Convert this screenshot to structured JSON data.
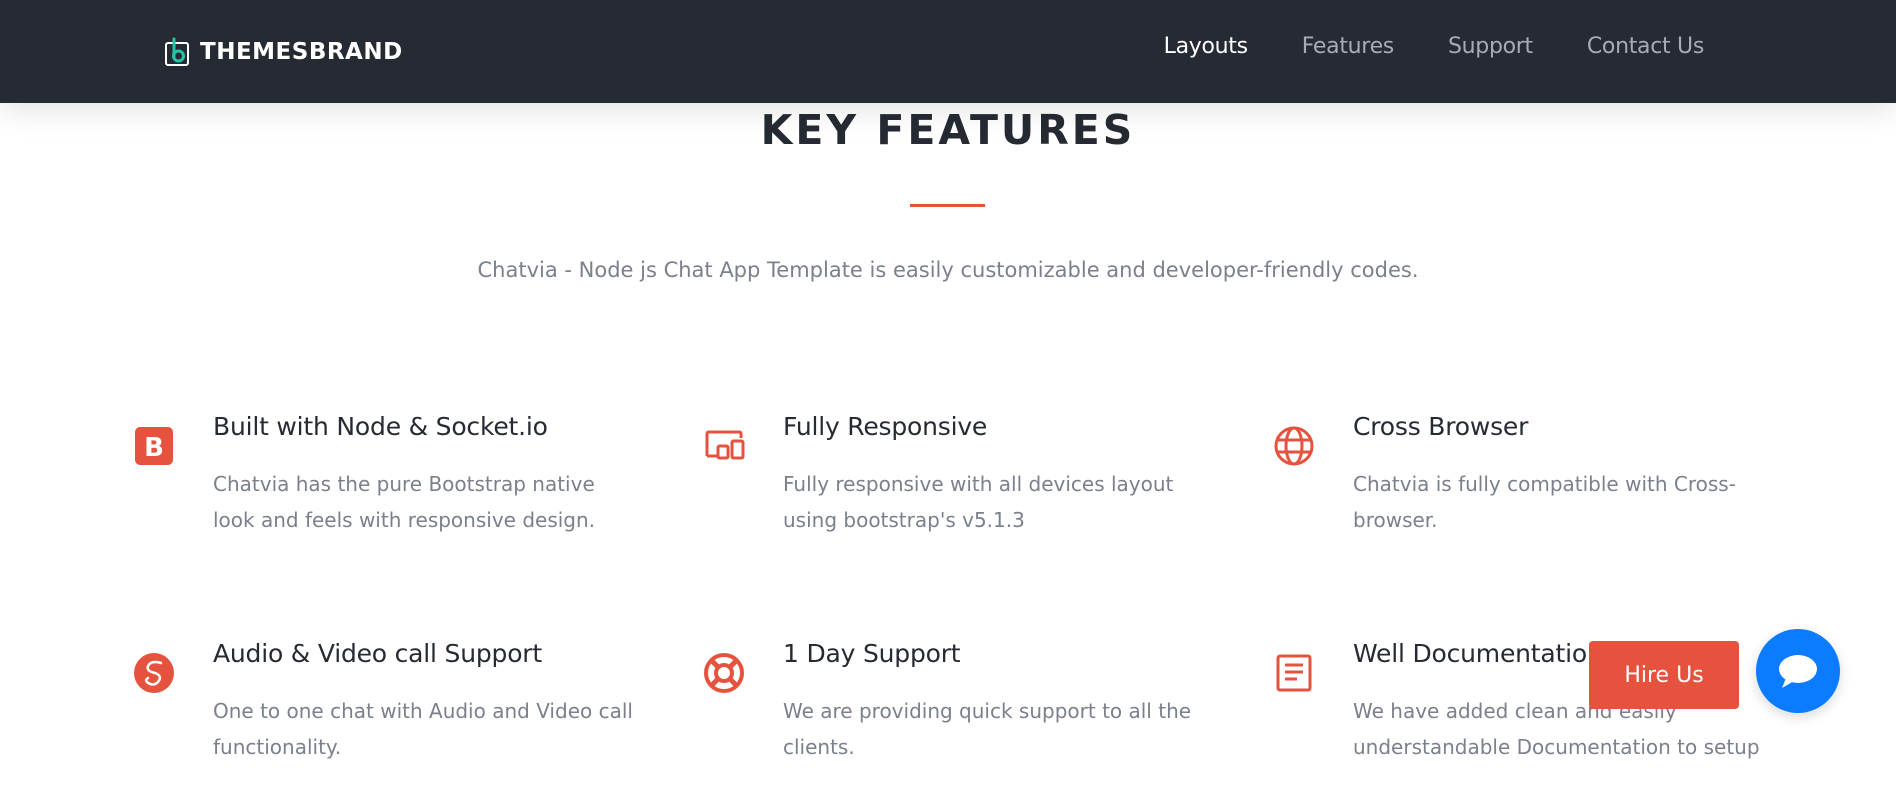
{
  "brand": {
    "name": "THEMESBRAND"
  },
  "nav": {
    "links": [
      {
        "label": "Layouts",
        "active": true
      },
      {
        "label": "Features"
      },
      {
        "label": "Support"
      },
      {
        "label": "Contact Us"
      }
    ]
  },
  "section": {
    "title": "KEY FEATURES",
    "subtitle": "Chatvia - Node js Chat App Template is easily customizable and developer-friendly codes."
  },
  "features": [
    {
      "icon": "bootstrap-icon",
      "title": "Built with Node & Socket.io",
      "desc": "Chatvia has the pure Bootstrap native look and feels with responsive design."
    },
    {
      "icon": "devices-icon",
      "title": "Fully Responsive",
      "desc": "Fully responsive with all devices layout using bootstrap's v5.1.3"
    },
    {
      "icon": "globe-icon",
      "title": "Cross Browser",
      "desc": "Chatvia is fully compatible with Cross-browser."
    },
    {
      "icon": "sass-icon",
      "title": "Audio & Video call Support",
      "desc": "One to one chat with Audio and Video call functionality."
    },
    {
      "icon": "lifebuoy-icon",
      "title": "1 Day Support",
      "desc": "We are providing quick support to all the clients."
    },
    {
      "icon": "document-icon",
      "title": "Well Documentation",
      "desc": "We have added clean and easily understandable Documentation to setup"
    }
  ],
  "floating": {
    "hire_label": "Hire Us",
    "chat_icon": "chat-bubble-icon"
  },
  "colors": {
    "navbar": "#262a33",
    "accent": "#e5533f",
    "chat": "#0b7cff",
    "text_muted": "#7a808c"
  }
}
